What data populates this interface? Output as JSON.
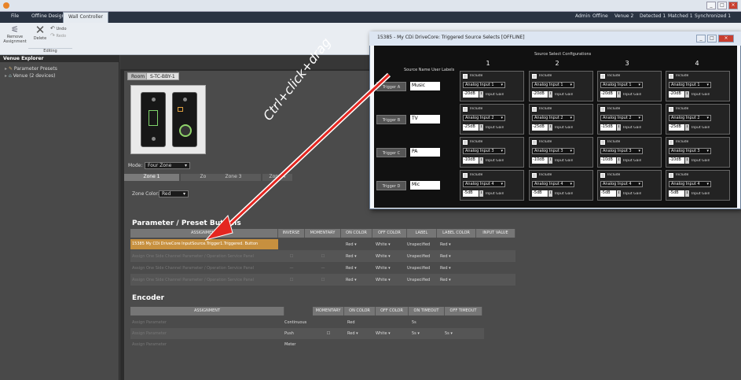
{
  "colors": {
    "accent_highlight": "#c7903f",
    "dialog_bg": "#111111",
    "arrow": "#e42620",
    "close_button": "#c93f30"
  },
  "tabs": [
    {
      "label": "File",
      "active": false
    },
    {
      "label": "Offline Design",
      "active": false
    },
    {
      "label": "Wall Controller",
      "active": true
    }
  ],
  "window_controls": {
    "minimize": "_",
    "maximize": "□",
    "close": "×"
  },
  "status": {
    "items": [
      "Venue 2",
      "Detected 1",
      "Matched 1",
      "Synchronized 1"
    ],
    "admin": "Admin",
    "mode": "Offline"
  },
  "ribbon": {
    "buttons": [
      {
        "label": "Remove Assignment",
        "icon": "remove-assignment-icon"
      },
      {
        "label": "Delete",
        "icon": "delete-x-icon"
      },
      {
        "label": "Undo",
        "icon": "undo-icon"
      },
      {
        "label": "Redo",
        "icon": "redo-icon"
      }
    ],
    "group": "Editing"
  },
  "sidebar": {
    "title": "Venue Explorer",
    "items": [
      {
        "label": "Parameter Presets",
        "icon": "preset-icon"
      },
      {
        "label": "Venue (2 devices)",
        "icon": "venue-icon"
      }
    ]
  },
  "doc": {
    "tabs": [
      {
        "label": "Room 1",
        "active": false
      },
      {
        "label": "S-TC-BBY-1",
        "active": true
      }
    ],
    "mode_label": "Mode:",
    "mode_value": "Four Zone",
    "zones": [
      "Zone 1",
      "Zone 2",
      "Zone 3",
      "Zone 4"
    ],
    "zone_color_label": "Zone Color:",
    "zone_color_value": "Red"
  },
  "param_section": {
    "title": "Parameter / Preset Buttons",
    "headers": [
      "ASSIGNMENT",
      "INVERSE",
      "MOMENTARY",
      "ON COLOR",
      "OFF COLOR",
      "LABEL",
      "LABEL COLOR",
      "INPUT VALUE"
    ],
    "rows": [
      {
        "assignment": "15385 My CDi DriveCore InputSource.Trigger1.Triggered. Button",
        "inverse": "",
        "momentary": "",
        "on": "Red",
        "off": "White",
        "label": "Unspecified",
        "label_color": "Red",
        "highlight": true
      },
      {
        "assignment": "Assign One Side Channel Parameter / Operation Service Panel",
        "inverse": "☐",
        "momentary": "☐",
        "on": "Red",
        "off": "White",
        "label": "Unspecified",
        "label_color": "Red",
        "highlight": false
      },
      {
        "assignment": "Assign One Side Channel Parameter / Operation Service Panel",
        "inverse": "—",
        "momentary": "—",
        "on": "Red",
        "off": "White",
        "label": "Unspecified",
        "label_color": "Red",
        "highlight": false
      },
      {
        "assignment": "Assign One Side Channel Parameter / Operation Service Panel",
        "inverse": "☐",
        "momentary": "☐",
        "on": "Red",
        "off": "White",
        "label": "Unspecified",
        "label_color": "Red",
        "highlight": false
      }
    ]
  },
  "encoder_section": {
    "title": "Encoder",
    "headers": [
      "ASSIGNMENT",
      "MOMENTARY",
      "ON COLOR",
      "OFF COLOR",
      "ON TIMEOUT",
      "OFF TIMEOUT"
    ],
    "rows": [
      {
        "assignment": "Assign Parameter",
        "type": "Continuous",
        "momentary": "",
        "on": "Red",
        "off": "",
        "on_timeout": "5s",
        "off_timeout": ""
      },
      {
        "assignment": "Assign Parameter",
        "type": "Push",
        "momentary": "☐",
        "on": "Red",
        "off": "White",
        "on_timeout": "5s",
        "off_timeout": "5s"
      },
      {
        "assignment": "Assign Parameter",
        "type": "Meter",
        "momentary": "",
        "on": "",
        "off": "",
        "on_timeout": "",
        "off_timeout": ""
      }
    ]
  },
  "dialog": {
    "title": "15385 - My CDi DriveCore: Triggered Source Selects [OFFLINE]",
    "config_title": "Source Select Configurations",
    "column_numbers": [
      "1",
      "2",
      "3",
      "4"
    ],
    "user_labels_title": "Source Name User Labels",
    "include_label": "Include",
    "input_gain_label": "Input Gain",
    "triggers": [
      {
        "name": "Trigger A",
        "label": "Music",
        "source": "Analog Input 1",
        "gains": [
          "-20dB",
          "-20dB",
          "-20dB",
          "-20dB"
        ]
      },
      {
        "name": "Trigger B",
        "label": "TV",
        "source": "Analog Input 2",
        "gains": [
          "-25dB",
          "-25dB",
          "-15dB",
          "-25dB"
        ]
      },
      {
        "name": "Trigger C",
        "label": "PA",
        "source": "Analog Input 3",
        "gains": [
          "-10dB",
          "-10dB",
          "-10dB",
          "-10dB"
        ]
      },
      {
        "name": "Trigger D",
        "label": "Mic",
        "source": "Analog Input 4",
        "gains": [
          "-5dB",
          "-5dB",
          "-5dB",
          "-5dB"
        ]
      }
    ]
  },
  "annotation": {
    "text": "Ctrl+click+drag"
  }
}
